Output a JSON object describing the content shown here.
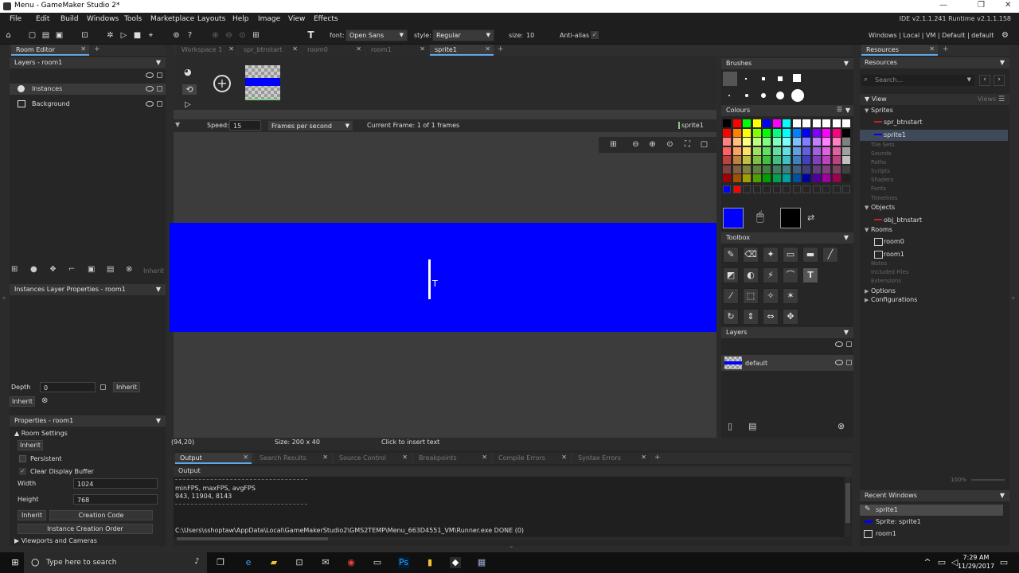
{
  "window": {
    "title": "Menu - GameMaker Studio 2*",
    "min": "—",
    "max": "❐",
    "close": "✕"
  },
  "menu": {
    "items": [
      "File",
      "Edit",
      "Build",
      "Windows",
      "Tools",
      "Marketplace",
      "Layouts",
      "Help",
      "Image",
      "View",
      "Effects"
    ],
    "version": "IDE v2.1.1.241 Runtime v2.1.1.158"
  },
  "toolbar": {
    "font_label": "font:",
    "font_value": "Open Sans",
    "style_label": "style:",
    "style_value": "Regular",
    "size_label": "size:",
    "size_value": "10",
    "antialias_label": "Anti-alias",
    "antialias_check": "✓",
    "target": "Windows | Local | VM | Default | default"
  },
  "room_editor": {
    "tab": "Room Editor",
    "layers_header": "Layers - room1",
    "layers": [
      "Instances",
      "Background"
    ],
    "inherit": "Inherit",
    "instances_props_header": "Instances Layer Properties - room1",
    "depth_label": "Depth",
    "depth_value": "0",
    "properties_header": "Properties - room1",
    "room_settings": "Room Settings",
    "persistent": "Persistent",
    "clear_display": "Clear Display Buffer",
    "clear_check": "✓",
    "width_label": "Width",
    "width_value": "1024",
    "height_label": "Height",
    "height_value": "768",
    "creation_code": "Creation Code",
    "instance_order": "Instance Creation Order",
    "viewports": "Viewports and Cameras"
  },
  "workspace_tabs": [
    "Workspace 1",
    "spr_btnstart",
    "room0",
    "room1",
    "sprite1"
  ],
  "sprite_editor": {
    "speed_label": "Speed:",
    "speed_value": "15",
    "fps_value": "Frames per second",
    "current_frame": "Current Frame: 1 of 1 frames",
    "sprite_name": "sprite1",
    "coords": "(94,20)",
    "size": "Size: 200 x 40",
    "hint": "Click to insert text",
    "canvas_color": "#0000ff",
    "add_frame_glyph": "+"
  },
  "brushes": {
    "header": "Brushes"
  },
  "colours": {
    "header": "Colours",
    "palette": [
      [
        "#000000",
        "#ff0000",
        "#00ff00",
        "#ffff00",
        "#0000ff",
        "#ff00ff",
        "#00ffff",
        "#ffffff",
        "#ffffff",
        "#ffffff",
        "#ffffff",
        "#ffffff",
        "#ffffff"
      ],
      [
        "#ff0000",
        "#ff8000",
        "#ffff00",
        "#80ff00",
        "#00ff00",
        "#00ff80",
        "#00ffff",
        "#0080ff",
        "#0000ff",
        "#8000ff",
        "#ff00ff",
        "#ff0080",
        "#000000"
      ],
      [
        "#ff8080",
        "#ffbf80",
        "#ffff80",
        "#bfff80",
        "#80ff80",
        "#80ffbf",
        "#80ffff",
        "#80bfff",
        "#8080ff",
        "#bf80ff",
        "#ff80ff",
        "#ff80bf",
        "#808080"
      ],
      [
        "#ff6060",
        "#ffa060",
        "#ffe060",
        "#a0e060",
        "#60e060",
        "#60e0a0",
        "#60e0e0",
        "#60a0e0",
        "#6060e0",
        "#a060e0",
        "#e060e0",
        "#e060a0",
        "#a0a0a0"
      ],
      [
        "#c04040",
        "#c08040",
        "#c0c040",
        "#80c040",
        "#40c040",
        "#40c080",
        "#40c0c0",
        "#4080c0",
        "#4040c0",
        "#8040c0",
        "#c040c0",
        "#c04080",
        "#c0c0c0"
      ],
      [
        "#804040",
        "#806040",
        "#808040",
        "#608040",
        "#408040",
        "#408060",
        "#408080",
        "#406080",
        "#404080",
        "#604080",
        "#804080",
        "#804060",
        "#404040"
      ],
      [
        "#a00000",
        "#a05000",
        "#a0a000",
        "#50a000",
        "#00a000",
        "#00a050",
        "#00a0a0",
        "#0050a0",
        "#0000a0",
        "#5000a0",
        "#a000a0",
        "#a00050",
        "#202020"
      ]
    ],
    "recent": [
      "#0000ff",
      "#ff0000"
    ],
    "primary": "#0000ff",
    "secondary": "#000000"
  },
  "toolbox": {
    "header": "Toolbox"
  },
  "layers_panel": {
    "header": "Layers",
    "layer": "default"
  },
  "zoom": "100%",
  "output": {
    "tabs": [
      "Output",
      "Search Results",
      "Source Control",
      "Breakpoints",
      "Compile Errors",
      "Syntax Errors"
    ],
    "title": "Output",
    "lines": [
      "minFPS, maxFPS, avgFPS",
      "943, 11904, 8143",
      "C:\\Users\\sshoptaw\\AppData\\Local\\GameMakerStudio2\\GMS2TEMP\\Menu_663D4551_VM\\Runner.exe DONE (0)"
    ]
  },
  "resources": {
    "tab": "Resources",
    "header": "Resources",
    "search_placeholder": "Search...",
    "view": "View",
    "views": "Views",
    "tree": [
      {
        "label": "Sprites",
        "dim": false,
        "indent": 0
      },
      {
        "label": "spr_btnstart",
        "dim": false,
        "indent": 1
      },
      {
        "label": "sprite1",
        "dim": false,
        "indent": 1
      },
      {
        "label": "Tile Sets",
        "dim": true,
        "indent": 0
      },
      {
        "label": "Sounds",
        "dim": true,
        "indent": 0
      },
      {
        "label": "Paths",
        "dim": true,
        "indent": 0
      },
      {
        "label": "Scripts",
        "dim": true,
        "indent": 0
      },
      {
        "label": "Shaders",
        "dim": true,
        "indent": 0
      },
      {
        "label": "Fonts",
        "dim": true,
        "indent": 0
      },
      {
        "label": "Timelines",
        "dim": true,
        "indent": 0
      },
      {
        "label": "Objects",
        "dim": false,
        "indent": 0
      },
      {
        "label": "obj_btnstart",
        "dim": false,
        "indent": 1
      },
      {
        "label": "Rooms",
        "dim": false,
        "indent": 0
      },
      {
        "label": "room0",
        "dim": false,
        "indent": 1
      },
      {
        "label": "room1",
        "dim": false,
        "indent": 1
      },
      {
        "label": "Notes",
        "dim": true,
        "indent": 0
      },
      {
        "label": "Included Files",
        "dim": true,
        "indent": 0
      },
      {
        "label": "Extensions",
        "dim": true,
        "indent": 0
      },
      {
        "label": "Options",
        "dim": false,
        "indent": 0
      },
      {
        "label": "Configurations",
        "dim": false,
        "indent": 0
      }
    ]
  },
  "recent_windows": {
    "header": "Recent Windows",
    "items": [
      "sprite1",
      "Sprite: sprite1",
      "room1"
    ]
  },
  "taskbar": {
    "search_placeholder": "Type here to search",
    "time": "7:29 AM",
    "date": "11/29/2017"
  }
}
